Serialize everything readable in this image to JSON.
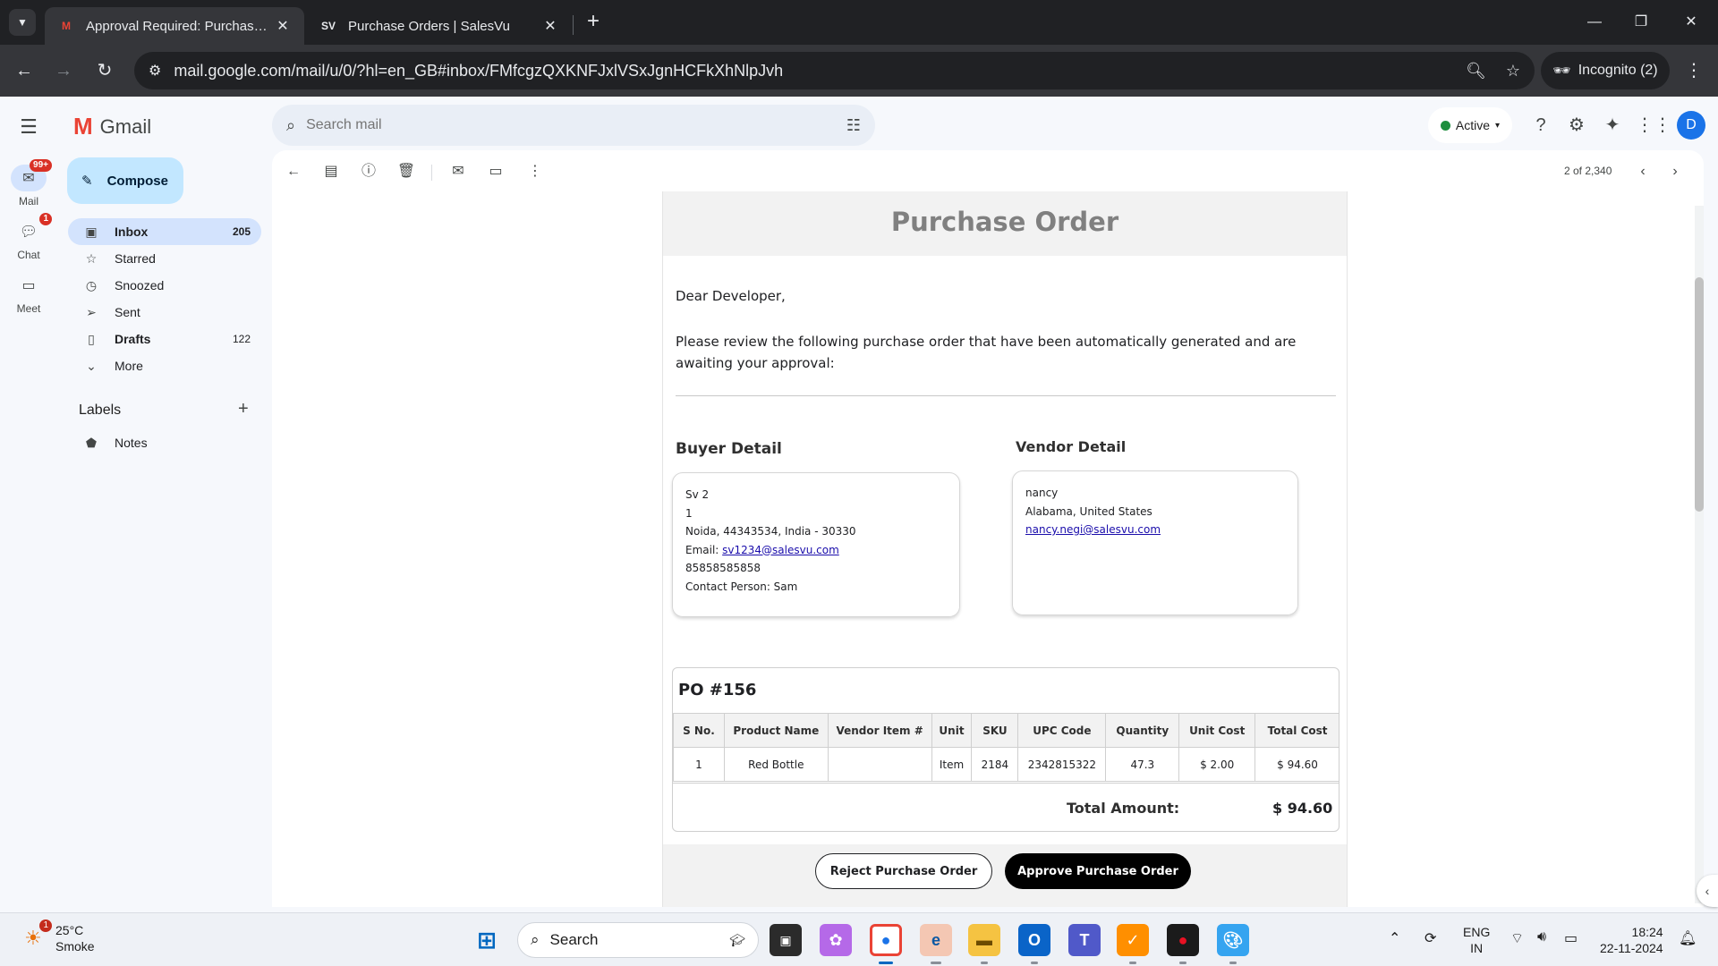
{
  "browser": {
    "tabs": [
      {
        "title": "Approval Required: Purchase Order",
        "favicon": "gmail-icon",
        "active": true
      },
      {
        "title": "Purchase Orders | SalesVu",
        "favicon": "SV",
        "active": false
      }
    ],
    "url": "mail.google.com/mail/u/0/?hl=en_GB#inbox/FMfcgzQXKNFJxlVSxJgnHCFkXhNlpJvh",
    "incognito_label": "Incognito (2)"
  },
  "gmail": {
    "app_name": "Gmail",
    "search_placeholder": "Search mail",
    "status_label": "Active",
    "avatar_letter": "D",
    "rail": [
      {
        "label": "Mail",
        "badge": "99+"
      },
      {
        "label": "Chat",
        "badge": "1"
      },
      {
        "label": "Meet",
        "badge": ""
      }
    ],
    "compose_label": "Compose",
    "nav": [
      {
        "label": "Inbox",
        "count": "205",
        "icon": "inbox-icon"
      },
      {
        "label": "Starred",
        "count": "",
        "icon": "star-icon"
      },
      {
        "label": "Snoozed",
        "count": "",
        "icon": "clock-icon"
      },
      {
        "label": "Sent",
        "count": "",
        "icon": "send-icon"
      },
      {
        "label": "Drafts",
        "count": "122",
        "icon": "draft-icon"
      },
      {
        "label": "More",
        "count": "",
        "icon": "chevron-down-icon"
      }
    ],
    "labels_heading": "Labels",
    "labels": [
      {
        "label": "Notes"
      }
    ],
    "pager": "2 of 2,340"
  },
  "email": {
    "header": "Purchase Order",
    "greeting": "Dear Developer,",
    "intro": "Please review the following purchase order that have been automatically generated and are awaiting your approval:",
    "buyer": {
      "heading": "Buyer Detail",
      "name": "Sv 2",
      "line2": "1",
      "address": "Noida, 44343534, India - 30330",
      "email_label": "Email: ",
      "email": "sv1234@salesvu.com",
      "phone": "85858585858",
      "contact": "Contact Person: Sam"
    },
    "vendor": {
      "heading": "Vendor Detail",
      "name": "nancy",
      "address": "Alabama, United States",
      "email": "nancy.negi@salesvu.com"
    },
    "po": {
      "number": "PO #156",
      "columns": [
        "S No.",
        "Product Name",
        "Vendor Item #",
        "Unit",
        "SKU",
        "UPC Code",
        "Quantity",
        "Unit Cost",
        "Total Cost"
      ],
      "rows": [
        [
          "1",
          "Red Bottle",
          "",
          "Item",
          "2184",
          "2342815322",
          "47.3",
          "$ 2.00",
          "$ 94.60"
        ]
      ],
      "total_label": "Total Amount:",
      "total_value": "$ 94.60"
    },
    "actions": {
      "reject": "Reject Purchase Order",
      "approve": "Approve Purchase Order"
    }
  },
  "taskbar": {
    "weather_temp": "25°C",
    "weather_desc": "Smoke",
    "weather_badge": "1",
    "search_label": "Search",
    "lang_top": "ENG",
    "lang_bottom": "IN",
    "time": "18:24",
    "date": "22-11-2024"
  }
}
